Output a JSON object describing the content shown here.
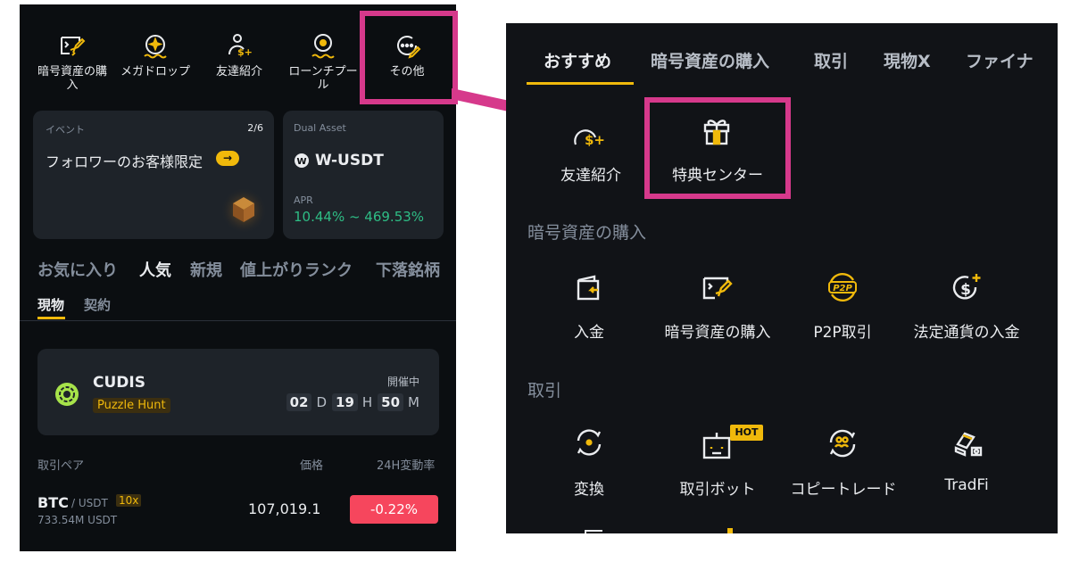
{
  "left": {
    "quick_actions": [
      {
        "label": "暗号資産の購\n入",
        "icon": "buy-crypto-icon"
      },
      {
        "label": "メガドロップ",
        "icon": "megadrop-icon"
      },
      {
        "label": "友達紹介",
        "icon": "referral-icon"
      },
      {
        "label": "ローンチプー\nル",
        "icon": "launchpool-icon"
      },
      {
        "label": "その他",
        "icon": "more-icon"
      }
    ],
    "event_card": {
      "tag": "イベント",
      "pager": "2/6",
      "title": "フォロワーのお客様限定",
      "arrow": "→"
    },
    "dual_card": {
      "tag": "Dual Asset",
      "coin": "W-USDT",
      "apr_label": "APR",
      "apr_value": "10.44% ~ 469.53%"
    },
    "market_tabs": [
      "お気に入り",
      "人気",
      "新規",
      "値上がりランク",
      "下落銘柄"
    ],
    "sub_tabs": [
      "現物",
      "契約"
    ],
    "promo": {
      "name": "CUDIS",
      "badge": "Puzzle Hunt",
      "status": "開催中",
      "days": "02",
      "d": "D",
      "hours": "19",
      "h": "H",
      "minutes": "50",
      "m": "M"
    },
    "columns": {
      "pair": "取引ペア",
      "price": "価格",
      "change": "24H変動率"
    },
    "row": {
      "base": "BTC",
      "quote": "/ USDT",
      "leverage": "10x",
      "volume": "733.54M USDT",
      "price": "107,019.1",
      "change": "-0.22%"
    }
  },
  "right": {
    "tabs": [
      "おすすめ",
      "暗号資産の購入",
      "取引",
      "現物X",
      "ファイナ"
    ],
    "top_items": [
      {
        "label": "友達紹介",
        "icon": "referral-icon"
      },
      {
        "label": "特典センター",
        "icon": "gift-icon"
      }
    ],
    "sections": [
      {
        "title": "暗号資産の購入",
        "items": [
          {
            "label": "入金",
            "icon": "deposit-icon"
          },
          {
            "label": "暗号資産の購入",
            "icon": "buy-crypto-icon"
          },
          {
            "label": "P2P取引",
            "icon": "p2p-icon"
          },
          {
            "label": "法定通貨の入金",
            "icon": "fiat-deposit-icon"
          }
        ]
      },
      {
        "title": "取引",
        "items": [
          {
            "label": "変換",
            "icon": "convert-icon"
          },
          {
            "label": "取引ボット",
            "icon": "trading-bot-icon",
            "badge": "HOT"
          },
          {
            "label": "コピートレード",
            "icon": "copy-trade-icon"
          },
          {
            "label": "TradFi",
            "icon": "tradfi-icon"
          }
        ]
      }
    ]
  },
  "colors": {
    "accent": "#f0b90b",
    "highlight": "#d6398b",
    "negative": "#f6465d",
    "positive": "#2ebd85",
    "background": "#0b0e11"
  }
}
